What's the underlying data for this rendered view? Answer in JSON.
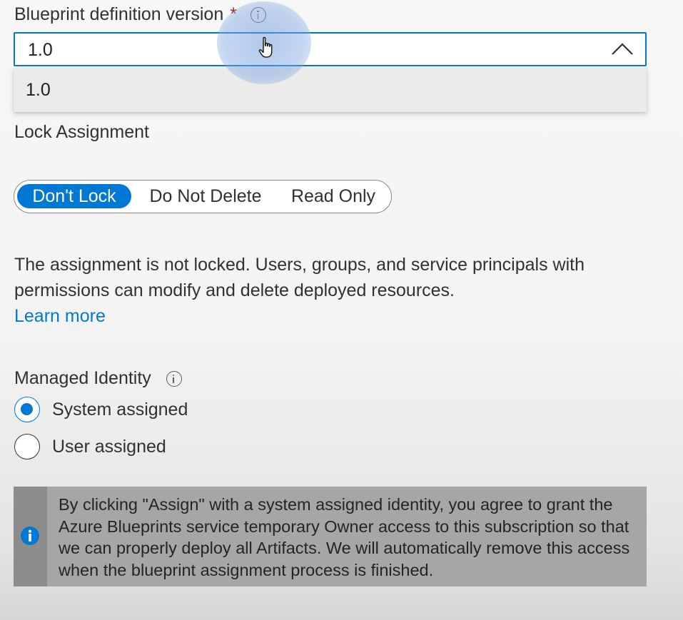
{
  "blueprint_version": {
    "label": "Blueprint definition version",
    "required_marker": "*",
    "selected_value": "1.0",
    "expanded": true,
    "options": [
      "1.0"
    ]
  },
  "lock_assignment": {
    "label": "Lock Assignment",
    "options": [
      "Don't Lock",
      "Do Not Delete",
      "Read Only"
    ],
    "selected": "Don't Lock",
    "description": "The assignment is not locked. Users, groups, and service principals with permissions can modify and delete deployed resources.",
    "learn_more": "Learn more"
  },
  "managed_identity": {
    "label": "Managed Identity",
    "options": [
      {
        "label": "System assigned",
        "checked": true
      },
      {
        "label": "User assigned",
        "checked": false
      }
    ]
  },
  "notice": {
    "text": "By clicking \"Assign\" with a system assigned identity, you agree to grant the Azure Blueprints service temporary Owner access to this subscription so that we can properly deploy all Artifacts. We will automatically remove this access when the blueprint assignment process is finished."
  },
  "icons": [
    "info-icon",
    "chevron-up-icon",
    "hand-cursor-icon",
    "info-filled-icon"
  ],
  "colors": {
    "accent": "#0078d4",
    "required": "#a4262c",
    "text": "#323130",
    "dropdown_list_bg": "#edebe9",
    "notice_bg": "#a6a6a6"
  }
}
